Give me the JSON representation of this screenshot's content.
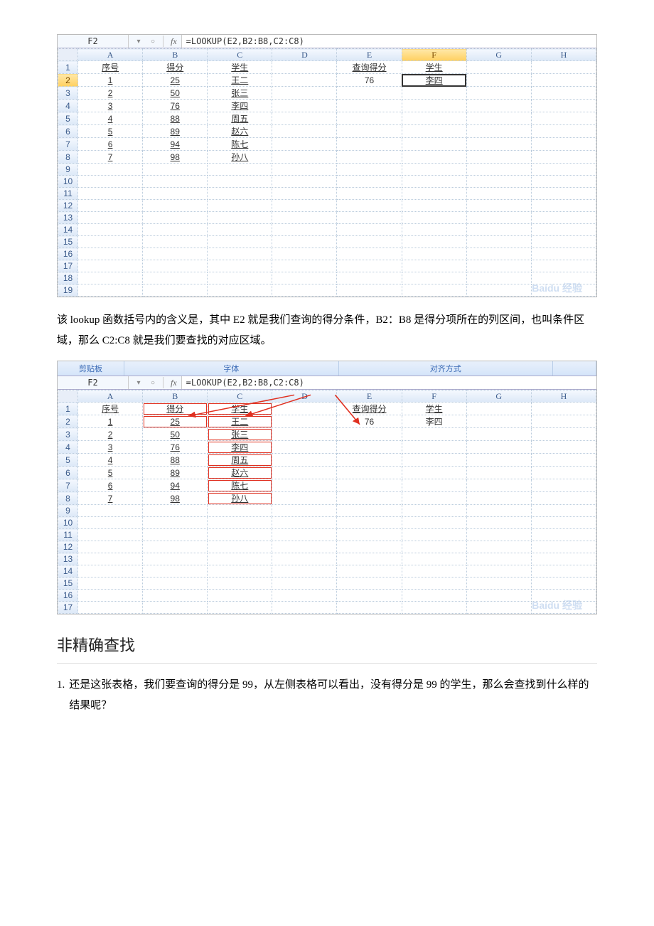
{
  "screenshot1": {
    "name_box": "F2",
    "formula": "=LOOKUP(E2,B2:B8,C2:C8)",
    "columns": [
      "A",
      "B",
      "C",
      "D",
      "E",
      "F",
      "G",
      "H"
    ],
    "selected_col": "F",
    "selected_row": "2",
    "rows": [
      "1",
      "2",
      "3",
      "4",
      "5",
      "6",
      "7",
      "8",
      "9",
      "10",
      "11",
      "12",
      "13",
      "14",
      "15",
      "16",
      "17",
      "18",
      "19"
    ],
    "header_row": {
      "A": "序号",
      "B": "得分",
      "C": "学生",
      "E": "查询得分",
      "F": "学生"
    },
    "data": [
      {
        "A": "1",
        "B": "25",
        "C": "王二",
        "E": "76",
        "F": "李四"
      },
      {
        "A": "2",
        "B": "50",
        "C": "张三"
      },
      {
        "A": "3",
        "B": "76",
        "C": "李四"
      },
      {
        "A": "4",
        "B": "88",
        "C": "周五"
      },
      {
        "A": "5",
        "B": "89",
        "C": "赵六"
      },
      {
        "A": "6",
        "B": "94",
        "C": "陈七"
      },
      {
        "A": "7",
        "B": "98",
        "C": "孙八"
      }
    ],
    "watermark": "Baidu 经验"
  },
  "paragraph1": "该 lookup 函数括号内的含义是，其中 E2 就是我们查询的得分条件，B2：B8 是得分项所在的列区间，也叫条件区域，那么 C2:C8 就是我们要查找的对应区域。",
  "screenshot2": {
    "ribbon": {
      "left": "剪贴板",
      "mid": "字体",
      "right": "对齐方式"
    },
    "name_box": "F2",
    "formula": "=LOOKUP(E2,B2:B8,C2:C8)",
    "columns": [
      "A",
      "B",
      "C",
      "D",
      "E",
      "F",
      "G",
      "H"
    ],
    "rows": [
      "1",
      "2",
      "3",
      "4",
      "5",
      "6",
      "7",
      "8",
      "9",
      "10",
      "11",
      "12",
      "13",
      "14",
      "15",
      "16",
      "17"
    ],
    "header_row": {
      "A": "序号",
      "B": "得分",
      "C": "学生",
      "E": "查询得分",
      "F": "学生"
    },
    "data": [
      {
        "A": "1",
        "B": "25",
        "C": "王二",
        "E": "76",
        "F": "李四"
      },
      {
        "A": "2",
        "B": "50",
        "C": "张三"
      },
      {
        "A": "3",
        "B": "76",
        "C": "李四"
      },
      {
        "A": "4",
        "B": "88",
        "C": "周五"
      },
      {
        "A": "5",
        "B": "89",
        "C": "赵六"
      },
      {
        "A": "6",
        "B": "94",
        "C": "陈七"
      },
      {
        "A": "7",
        "B": "98",
        "C": "孙八"
      }
    ],
    "watermark": "Baidu 经验"
  },
  "heading": "非精确查找",
  "list": {
    "num": "1.",
    "text": "还是这张表格，我们要查询的得分是 99，从左侧表格可以看出，没有得分是 99 的学生，那么会查找到什么样的结果呢？"
  },
  "icons": {
    "dropdown": "▾",
    "circle": "○",
    "fx": "fx"
  }
}
